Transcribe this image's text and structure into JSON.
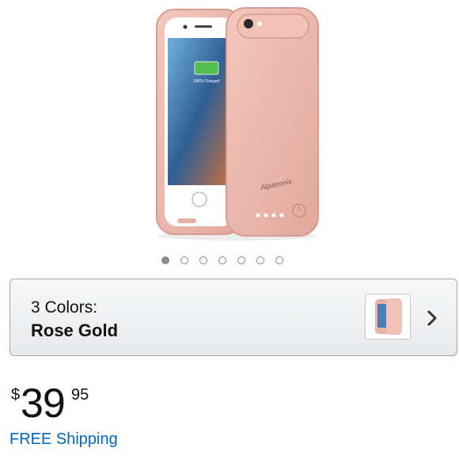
{
  "product": {
    "image_alt": "Rose gold battery case for iPhone",
    "brand_on_case": "Alpatronix",
    "screen_text": "100% Charged"
  },
  "carousel": {
    "total": 7,
    "active_index": 0
  },
  "color_selector": {
    "count_label": "3 Colors:",
    "selected_color": "Rose Gold"
  },
  "price": {
    "symbol": "$",
    "whole": "39",
    "fraction": "95"
  },
  "shipping": {
    "label": "FREE Shipping"
  },
  "colors": {
    "accent_link": "#0066c0",
    "rose_gold": "#e9b3a8",
    "dot_active": "#8a8a8a"
  }
}
